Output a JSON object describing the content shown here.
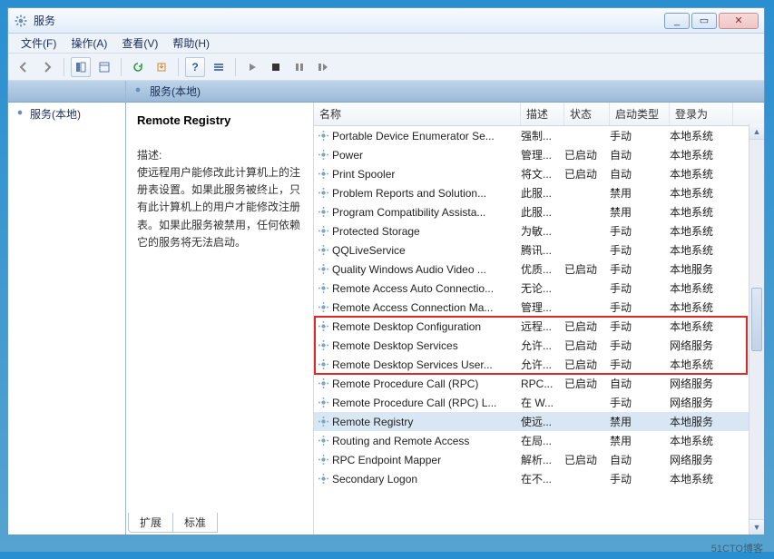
{
  "window": {
    "title": "服务",
    "min_tip": "_",
    "max_tip": "▭",
    "close_tip": "✕"
  },
  "menu": {
    "file": "文件(F)",
    "action": "操作(A)",
    "view": "查看(V)",
    "help": "帮助(H)"
  },
  "left": {
    "root": "服务(本地)"
  },
  "panel": {
    "heading": "服务(本地)",
    "selected_name": "Remote Registry",
    "desc_label": "描述:",
    "description": "使远程用户能修改此计算机上的注册表设置。如果此服务被终止，只有此计算机上的用户才能修改注册表。如果此服务被禁用，任何依赖它的服务将无法启动。"
  },
  "columns": {
    "name": "名称",
    "desc": "描述",
    "status": "状态",
    "start": "启动类型",
    "logon": "登录为"
  },
  "rows": [
    {
      "name": "Portable Device Enumerator Se...",
      "desc": "强制...",
      "status": "",
      "start": "手动",
      "logon": "本地系统"
    },
    {
      "name": "Power",
      "desc": "管理...",
      "status": "已启动",
      "start": "自动",
      "logon": "本地系统"
    },
    {
      "name": "Print Spooler",
      "desc": "将文...",
      "status": "已启动",
      "start": "自动",
      "logon": "本地系统"
    },
    {
      "name": "Problem Reports and Solution...",
      "desc": "此服...",
      "status": "",
      "start": "禁用",
      "logon": "本地系统"
    },
    {
      "name": "Program Compatibility Assista...",
      "desc": "此服...",
      "status": "",
      "start": "禁用",
      "logon": "本地系统"
    },
    {
      "name": "Protected Storage",
      "desc": "为敏...",
      "status": "",
      "start": "手动",
      "logon": "本地系统"
    },
    {
      "name": "QQLiveService",
      "desc": "腾讯...",
      "status": "",
      "start": "手动",
      "logon": "本地系统"
    },
    {
      "name": "Quality Windows Audio Video ...",
      "desc": "优质...",
      "status": "已启动",
      "start": "手动",
      "logon": "本地服务"
    },
    {
      "name": "Remote Access Auto Connectio...",
      "desc": "无论...",
      "status": "",
      "start": "手动",
      "logon": "本地系统"
    },
    {
      "name": "Remote Access Connection Ma...",
      "desc": "管理...",
      "status": "",
      "start": "手动",
      "logon": "本地系统"
    },
    {
      "name": "Remote Desktop Configuration",
      "desc": "远程...",
      "status": "已启动",
      "start": "手动",
      "logon": "本地系统"
    },
    {
      "name": "Remote Desktop Services",
      "desc": "允许...",
      "status": "已启动",
      "start": "手动",
      "logon": "网络服务"
    },
    {
      "name": "Remote Desktop Services User...",
      "desc": "允许...",
      "status": "已启动",
      "start": "手动",
      "logon": "本地系统"
    },
    {
      "name": "Remote Procedure Call (RPC)",
      "desc": "RPC...",
      "status": "已启动",
      "start": "自动",
      "logon": "网络服务"
    },
    {
      "name": "Remote Procedure Call (RPC) L...",
      "desc": "在 W...",
      "status": "",
      "start": "手动",
      "logon": "网络服务"
    },
    {
      "name": "Remote Registry",
      "desc": "使远...",
      "status": "",
      "start": "禁用",
      "logon": "本地服务",
      "selected": true
    },
    {
      "name": "Routing and Remote Access",
      "desc": "在局...",
      "status": "",
      "start": "禁用",
      "logon": "本地系统"
    },
    {
      "name": "RPC Endpoint Mapper",
      "desc": "解析...",
      "status": "已启动",
      "start": "自动",
      "logon": "网络服务"
    },
    {
      "name": "Secondary Logon",
      "desc": "在不...",
      "status": "",
      "start": "手动",
      "logon": "本地系统"
    }
  ],
  "tabs": {
    "extended": "扩展",
    "standard": "标准"
  },
  "watermark": "51CTO博客"
}
